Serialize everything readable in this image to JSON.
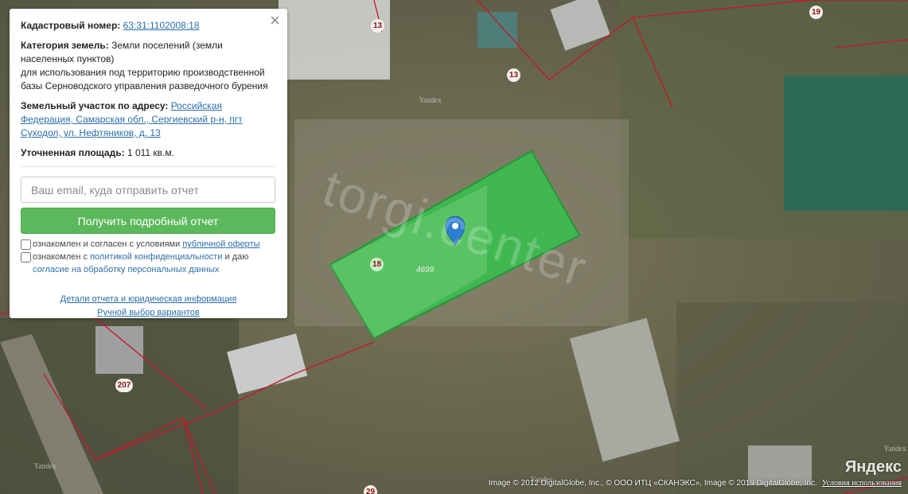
{
  "info": {
    "cadastral_label": "Кадастровый номер:",
    "cadastral_value": "63:31:1102008:18",
    "category_label": "Категория земель:",
    "category_value": "Земли поселений (земли населенных пунктов)",
    "usage_text": "для использования под территорию производственной базы Серноводского управления разведочного бурения",
    "address_label": "Земельный участок по адресу:",
    "address_value": "Российская Федерация, Самарская обл., Сергиевский р-н, пгт Суходол, ул. Нефтяников, д. 13",
    "area_label": "Уточненная площадь:",
    "area_value": "1 011 кв.м."
  },
  "form": {
    "email_placeholder": "Ваш email, куда отправить отчет",
    "submit_label": "Получить подробный отчет",
    "consent1_text": "ознакомлен и согласен с условиями",
    "consent1_link": "публичной оферты",
    "consent2_text": "ознакомлен с",
    "consent2_link": "политикой конфиденциальности",
    "consent2_and": "и даю",
    "consent2_link2": "согласие на обработку персональных данных"
  },
  "links": {
    "details": "Детали отчета и юридическая информация",
    "manual": "Ручной выбор вариантов"
  },
  "close_icon": "×",
  "map": {
    "parcel_numbers": [
      "13",
      "13",
      "19",
      "207",
      "18",
      "29"
    ],
    "parcel_area_label": "4699",
    "watermarks": [
      "Yandex",
      "Yandex",
      "Yandex",
      "Yandex"
    ],
    "big_watermark": "torgi.center",
    "logo": "Яндекс",
    "copyright": "Image © 2012 DigitalGlobe, Inc., © ООО ИТЦ «СКАНЭКС», Image © 2019 DigitalGlobe, Inc.",
    "terms": "Условия использования",
    "colors": {
      "parcel_fill": "#2ec84a",
      "boundary": "#c8142a",
      "marker": "#2f7fd1"
    }
  }
}
